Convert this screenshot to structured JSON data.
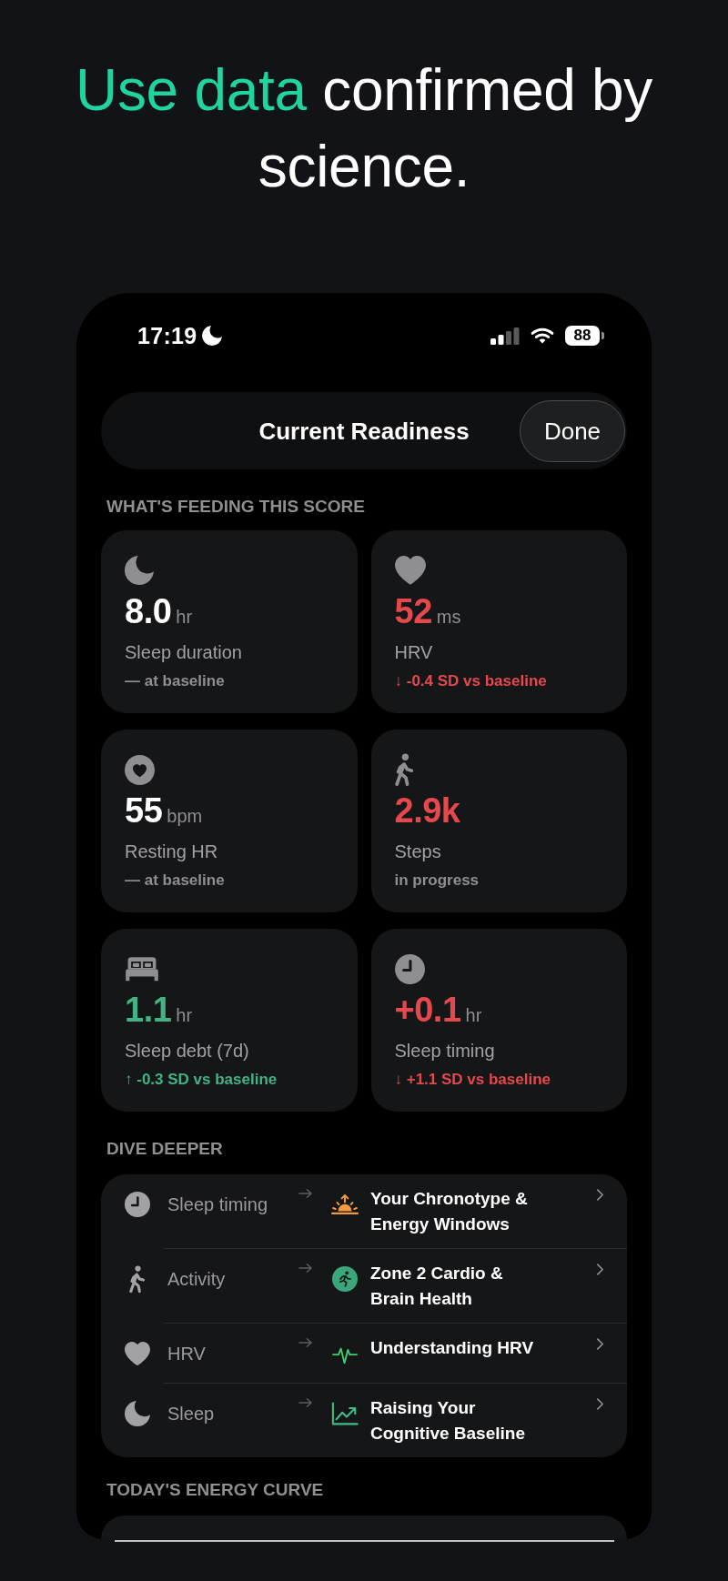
{
  "headline": [
    {
      "text": "Use data",
      "accent": true
    },
    {
      "text": " confirmed by science.",
      "accent": false
    }
  ],
  "status_bar": {
    "time": "17:19",
    "battery": "88"
  },
  "header": {
    "title": "Current Readiness",
    "done_button": "Done"
  },
  "score_inputs": {
    "heading": "WHAT'S FEEDING THIS SCORE",
    "metrics": [
      {
        "kind": "sleep",
        "value": {
          "text": "8.0",
          "color": "#ffffff"
        },
        "unit": "hr",
        "label": "Sleep duration",
        "note": {
          "text": "— at baseline",
          "color": "#8e8e93"
        }
      },
      {
        "kind": "hrv",
        "value": {
          "text": "52",
          "color": "#e5484d"
        },
        "unit": "ms",
        "label": "HRV",
        "note": {
          "text": "↓ -0.4 SD vs baseline",
          "color": "#e5484d"
        }
      },
      {
        "kind": "resting_hr",
        "value": {
          "text": "55",
          "color": "#ffffff"
        },
        "unit": "bpm",
        "label": "Resting HR",
        "note": {
          "text": "— at baseline",
          "color": "#8e8e93"
        }
      },
      {
        "kind": "steps",
        "value": {
          "text": "2.9k",
          "color": "#e5484d"
        },
        "label": "Steps",
        "note": {
          "text": "in progress",
          "color": "#8e8e93"
        }
      },
      {
        "kind": "sleep_debt",
        "value": {
          "text": "1.1",
          "color": "#41b385"
        },
        "unit": "hr",
        "label": "Sleep debt (7d)",
        "note": {
          "text": "↑ -0.3 SD vs baseline",
          "color": "#41b385"
        }
      },
      {
        "kind": "sleep_timing",
        "value": {
          "text": "+0.1",
          "color": "#e5484d"
        },
        "unit": "hr",
        "label": "Sleep timing",
        "note": {
          "text": "↓ +1.1 SD vs baseline",
          "color": "#e5484d"
        }
      }
    ]
  },
  "dive_deeper": {
    "heading": "DIVE DEEPER",
    "items": [
      {
        "kind": "timing",
        "topic": "Sleep timing",
        "title": "Your Chronotype & Energy Windows"
      },
      {
        "kind": "activity",
        "topic": "Activity",
        "title": "Zone 2 Cardio & Brain Health"
      },
      {
        "kind": "hrv",
        "topic": "HRV",
        "title": "Understanding HRV"
      },
      {
        "kind": "sleep",
        "topic": "Sleep",
        "title": "Raising Your Cognitive Baseline"
      }
    ]
  },
  "energy_curve": {
    "heading": "TODAY'S ENERGY CURVE"
  }
}
